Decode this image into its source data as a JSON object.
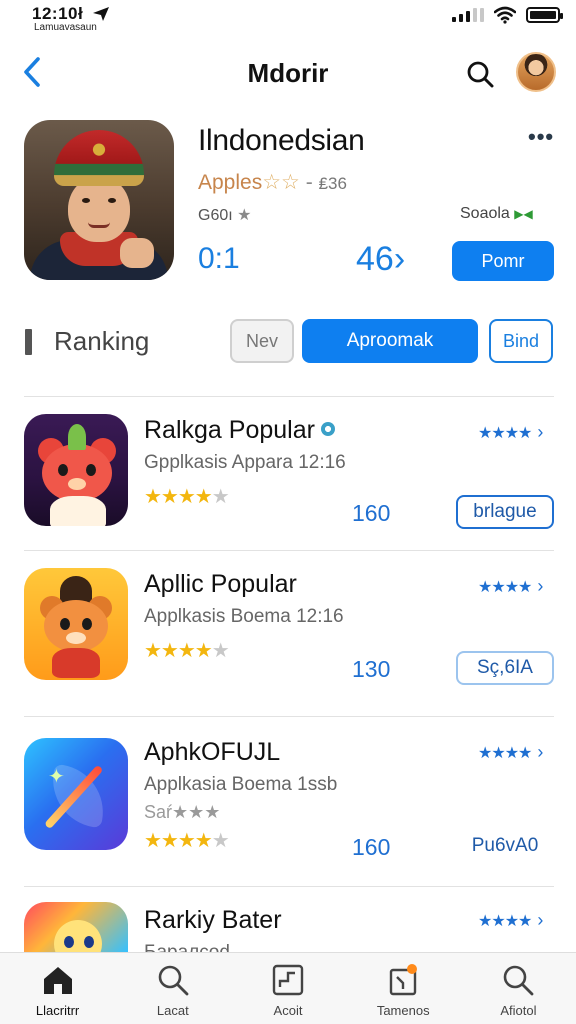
{
  "status": {
    "time": "12:10",
    "time_suffix": "ł",
    "sub": "Lamuavasaun"
  },
  "nav": {
    "title": "Mdorir"
  },
  "hero": {
    "title": "Ilndonedsian",
    "sub_text": "Apples",
    "sub_stars": "☆☆",
    "sub_dash": "-",
    "sub_num": "₤36",
    "meta": "G60ı",
    "seller": "Soaola",
    "stat_1": "0:1",
    "stat_2": "46›",
    "action_label": "Pomr"
  },
  "ranking": {
    "label": "Ranking",
    "segments": [
      "Nev",
      "Aproomak",
      "Bind"
    ]
  },
  "apps": [
    {
      "name": "Ralkga Popular",
      "subtitle": "Gpplkasis Appara 12:16",
      "subtitle2": "",
      "rating": 4,
      "count": "160",
      "badge": "brlague"
    },
    {
      "name": "Apllic Popular",
      "subtitle": "Applkasis Boema 12:16",
      "subtitle2": "",
      "rating": 4,
      "count": "130",
      "badge": "Sç,6IA"
    },
    {
      "name": "AphkOFUJL",
      "subtitle": "Applkasia Boema 1ssb",
      "subtitle2": "Saŕ★★★",
      "rating": 4,
      "count": "160",
      "badge": "Pu6vA0"
    },
    {
      "name": "Rarkiy Bater",
      "subtitle": "Баралcоd",
      "subtitle2": "",
      "rating": 4,
      "count": "",
      "badge": ""
    }
  ],
  "tabs": [
    {
      "label": "Llacritrr",
      "icon": "home-icon"
    },
    {
      "label": "Lacat",
      "icon": "search-icon"
    },
    {
      "label": "Acoit",
      "icon": "chart-icon"
    },
    {
      "label": "Tamenos",
      "icon": "updates-icon"
    },
    {
      "label": "Afiotol",
      "icon": "search-icon"
    }
  ],
  "colors": {
    "accent": "#0e7ff0",
    "star": "#f3b60f",
    "text": "#111111"
  }
}
